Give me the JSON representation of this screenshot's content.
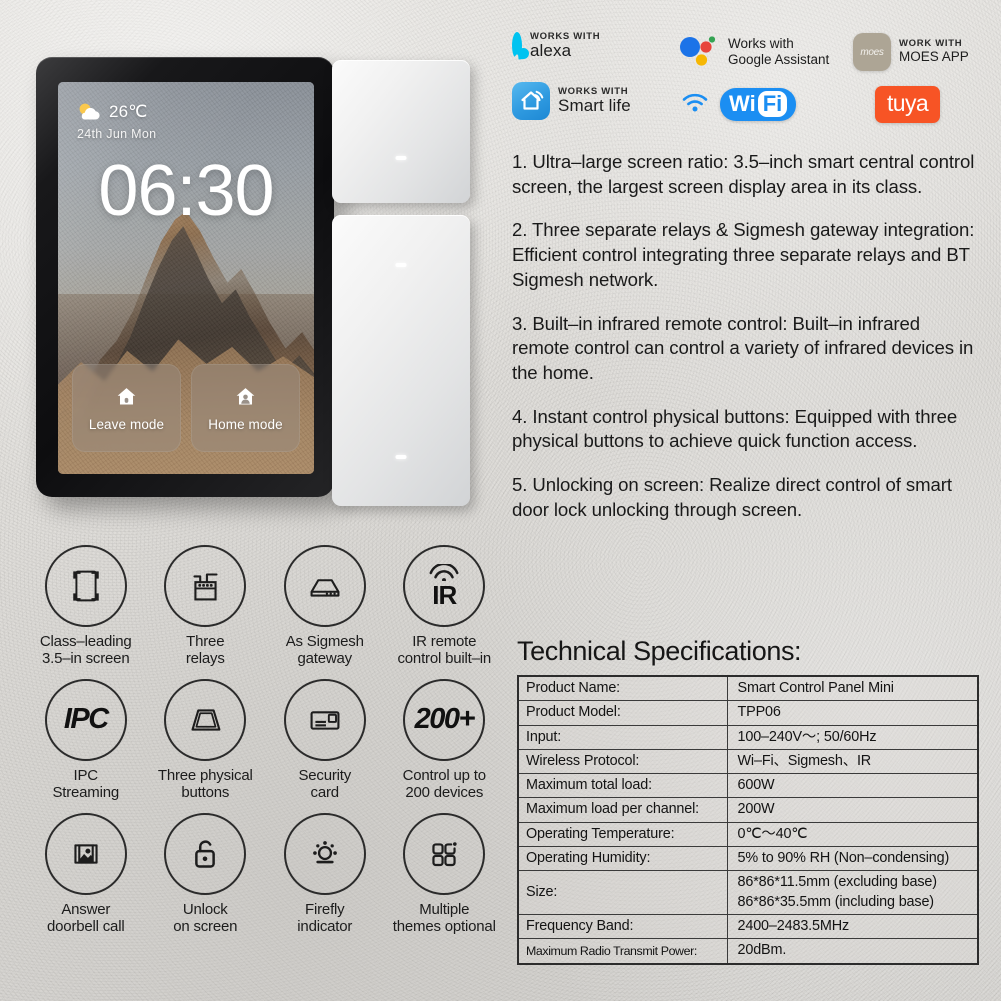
{
  "device": {
    "screen": {
      "weather_icon": "sun-behind-cloud-icon",
      "temperature": "26℃",
      "date": "24th Jun  Mon",
      "time": "06:30",
      "modes": [
        {
          "icon": "house-icon",
          "label": "Leave mode"
        },
        {
          "icon": "person-in-house-icon",
          "label": "Home mode"
        }
      ]
    },
    "physical_buttons": {
      "count": 3,
      "led_indicator": "white-led-bar"
    }
  },
  "badges": [
    {
      "id": "alexa",
      "icon": "alexa-ring-icon",
      "kicker": "WORKS WITH",
      "name": "alexa",
      "color": "#00c3f0"
    },
    {
      "id": "smart-life",
      "icon": "smart-life-house-icon",
      "kicker": "WORKS WITH",
      "name": "Smart life",
      "color": "#2f9ae0"
    },
    {
      "id": "google-assistant",
      "icon": "google-assistant-dots-icon",
      "kicker": "Works with",
      "name": "Google Assistant",
      "color": "#1b73e8"
    },
    {
      "id": "wifi",
      "icon": "wifi-signal-icon",
      "name_a": "Wi",
      "name_b": "Fi",
      "color": "#1b8ef2"
    },
    {
      "id": "moes-app",
      "icon": "moes-tile-icon",
      "kicker": "WORK WITH",
      "name": "MOES APP",
      "tile_text": "moes",
      "color": "#ada595"
    },
    {
      "id": "tuya",
      "icon": "tuya-logo-icon",
      "name": "tuya",
      "color": "#f75425"
    }
  ],
  "features": [
    "1. Ultra–large screen ratio: 3.5–inch smart central control screen, the largest screen display area in its class.",
    "2. Three separate relays & Sigmesh gateway integration: Efficient control integrating three separate relays and BT Sigmesh network.",
    "3. Built–in infrared remote control: Built–in infrared remote control can control a variety of infrared devices in the home.",
    "4. Instant control physical buttons: Equipped with three physical buttons to achieve quick function access.",
    "5. Unlocking on screen: Realize direct control of smart door lock unlocking through screen."
  ],
  "icon_features": [
    {
      "icon": "screen-frame-icon",
      "caption": "Class–leading\n3.5–in screen"
    },
    {
      "icon": "relay-module-icon",
      "caption": "Three\nrelays"
    },
    {
      "icon": "gateway-hub-icon",
      "caption": "As Sigmesh\ngateway"
    },
    {
      "icon": "ir-remote-icon",
      "caption": "IR remote\ncontrol built–in",
      "glyph": "IR"
    },
    {
      "icon": "ipc-streaming-icon",
      "caption": "IPC\nStreaming",
      "glyph": "IPC"
    },
    {
      "icon": "physical-buttons-icon",
      "caption": "Three physical\nbuttons"
    },
    {
      "icon": "security-card-icon",
      "caption": "Security\ncard"
    },
    {
      "icon": "device-count-icon",
      "caption": "Control up to\n200 devices",
      "glyph": "200+"
    },
    {
      "icon": "doorbell-image-icon",
      "caption": "Answer\ndoorbell call"
    },
    {
      "icon": "unlock-padlock-icon",
      "caption": "Unlock\non screen"
    },
    {
      "icon": "firefly-brightness-icon",
      "caption": "Firefly\nindicator"
    },
    {
      "icon": "themes-grid-icon",
      "caption": "Multiple\nthemes optional"
    }
  ],
  "specs": {
    "title": "Technical Specifications:",
    "rows": [
      {
        "key": "Product Name:",
        "value": "Smart Control Panel Mini"
      },
      {
        "key": "Product Model:",
        "value": "TPP06"
      },
      {
        "key": "Input:",
        "value": "100–240V～;  50/60Hz"
      },
      {
        "key": "Wireless Protocol:",
        "value": "Wi–Fi、Sigmesh、IR"
      },
      {
        "key": "Maximum total load:",
        "value": "600W"
      },
      {
        "key": "Maximum load per channel:",
        "value": "200W"
      },
      {
        "key": "Operating Temperature:",
        "value": "0℃～40℃"
      },
      {
        "key": "Operating Humidity:",
        "value": "5% to 90% RH (Non–condensing)"
      },
      {
        "key": "Size:",
        "value": "86*86*11.5mm (excluding base)",
        "value2": "86*86*35.5mm (including base)"
      },
      {
        "key": "Frequency Band:",
        "value": "2400–2483.5MHz"
      },
      {
        "key": "Maximum Radio Transmit Power:",
        "value": "20dBm.",
        "tight": true
      }
    ]
  }
}
